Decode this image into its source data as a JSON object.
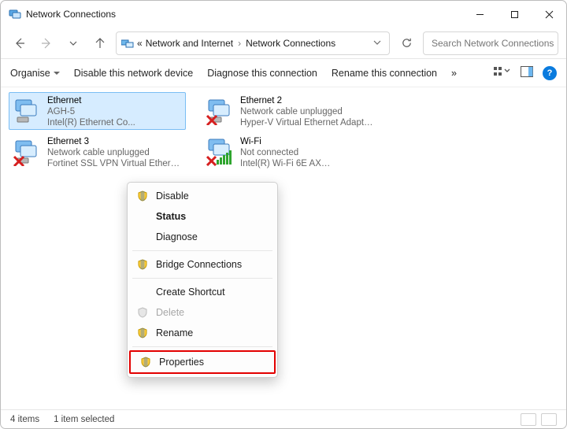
{
  "window": {
    "title": "Network Connections"
  },
  "breadcrumbs": {
    "icon_label": "network-icon",
    "root_sep": "«",
    "seg1": "Network and Internet",
    "seg2": "Network Connections"
  },
  "search": {
    "placeholder": "Search Network Connections"
  },
  "toolbar": {
    "organise": "Organise",
    "disable": "Disable this network device",
    "diagnose": "Diagnose this connection",
    "rename": "Rename this connection",
    "more": "»"
  },
  "items": [
    {
      "name": "Ethernet",
      "status": "AGH-5",
      "device": "Intel(R) Ethernet Co...",
      "overlay": "none",
      "selected": true
    },
    {
      "name": "Ethernet 2",
      "status": "Network cable unplugged",
      "device": "Hyper-V Virtual Ethernet Adapter (…",
      "overlay": "cross",
      "selected": false
    },
    {
      "name": "Ethernet 3",
      "status": "Network cable unplugged",
      "device": "Fortinet SSL VPN Virtual Ethernet …",
      "overlay": "cross",
      "selected": false
    },
    {
      "name": "Wi-Fi",
      "status": "Not connected",
      "device": "Intel(R) Wi-Fi 6E AX…",
      "overlay": "wifi-cross",
      "selected": false
    }
  ],
  "context_menu": {
    "disable": "Disable",
    "status": "Status",
    "diagnose": "Diagnose",
    "bridge": "Bridge Connections",
    "shortcut": "Create Shortcut",
    "delete": "Delete",
    "rename": "Rename",
    "properties": "Properties"
  },
  "statusbar": {
    "count": "4 items",
    "selected": "1 item selected"
  },
  "help_glyph": "?"
}
